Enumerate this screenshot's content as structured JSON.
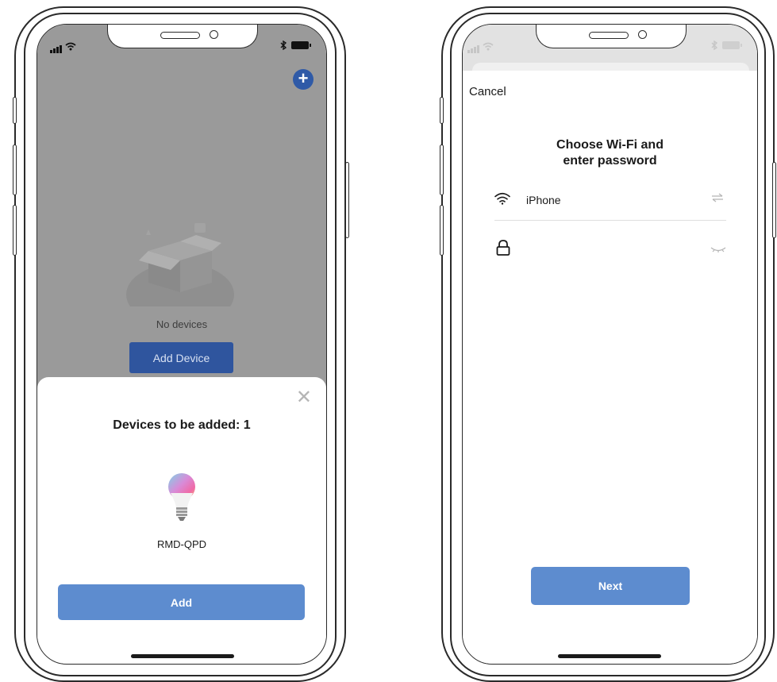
{
  "left_phone": {
    "background": {
      "empty_state_text": "No devices",
      "add_device_label": "Add Device",
      "plus_icon": "plus-icon"
    },
    "sheet": {
      "close_icon": "close-icon",
      "title": "Devices to be added: 1",
      "device_icon": "light-bulb-icon",
      "device_name": "RMD-QPD",
      "add_label": "Add"
    }
  },
  "right_phone": {
    "cancel_label": "Cancel",
    "title_line1": "Choose Wi-Fi and",
    "title_line2": "enter password",
    "wifi": {
      "icon": "wifi-icon",
      "ssid": "iPhone",
      "switch_icon": "swap-arrows-icon"
    },
    "password": {
      "icon": "lock-icon",
      "value": "",
      "visibility_icon": "eye-closed-icon"
    },
    "next_label": "Next"
  },
  "colors": {
    "primary_button": "#5d8ccf",
    "dimmed_button": "#2f559e",
    "overlay_gray": "#9a9a9a"
  }
}
